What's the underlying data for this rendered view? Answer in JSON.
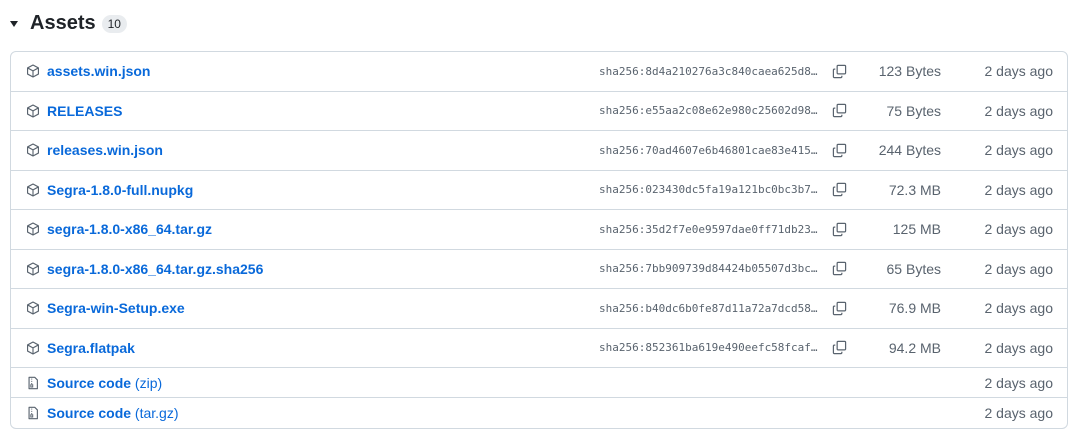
{
  "section": {
    "title": "Assets",
    "count": "10"
  },
  "assets": [
    {
      "name": "assets.win.json",
      "digest": "sha256:8d4a210276a3c840caea625d85…",
      "size": "123 Bytes",
      "date": "2 days ago"
    },
    {
      "name": "RELEASES",
      "digest": "sha256:e55aa2c08e62e980c25602d98d…",
      "size": "75 Bytes",
      "date": "2 days ago"
    },
    {
      "name": "releases.win.json",
      "digest": "sha256:70ad4607e6b46801cae83e4150…",
      "size": "244 Bytes",
      "date": "2 days ago"
    },
    {
      "name": "Segra-1.8.0-full.nupkg",
      "digest": "sha256:023430dc5fa19a121bc0bc3b7c…",
      "size": "72.3 MB",
      "date": "2 days ago"
    },
    {
      "name": "segra-1.8.0-x86_64.tar.gz",
      "digest": "sha256:35d2f7e0e9597dae0ff71db238…",
      "size": "125 MB",
      "date": "2 days ago"
    },
    {
      "name": "segra-1.8.0-x86_64.tar.gz.sha256",
      "digest": "sha256:7bb909739d84424b05507d3bc4…",
      "size": "65 Bytes",
      "date": "2 days ago"
    },
    {
      "name": "Segra-win-Setup.exe",
      "digest": "sha256:b40dc6b0fe87d11a72a7dcd58f…",
      "size": "76.9 MB",
      "date": "2 days ago"
    },
    {
      "name": "Segra.flatpak",
      "digest": "sha256:852361ba619e490eefc58fcaf1…",
      "size": "94.2 MB",
      "date": "2 days ago"
    }
  ],
  "source_code": [
    {
      "name": "Source code",
      "suffix": "(zip)",
      "date": "2 days ago"
    },
    {
      "name": "Source code",
      "suffix": "(tar.gz)",
      "date": "2 days ago"
    }
  ],
  "icons": {
    "toggle": "triangle-down-icon",
    "file": "package-icon",
    "source": "file-zip-icon",
    "copy": "copy-icon"
  }
}
